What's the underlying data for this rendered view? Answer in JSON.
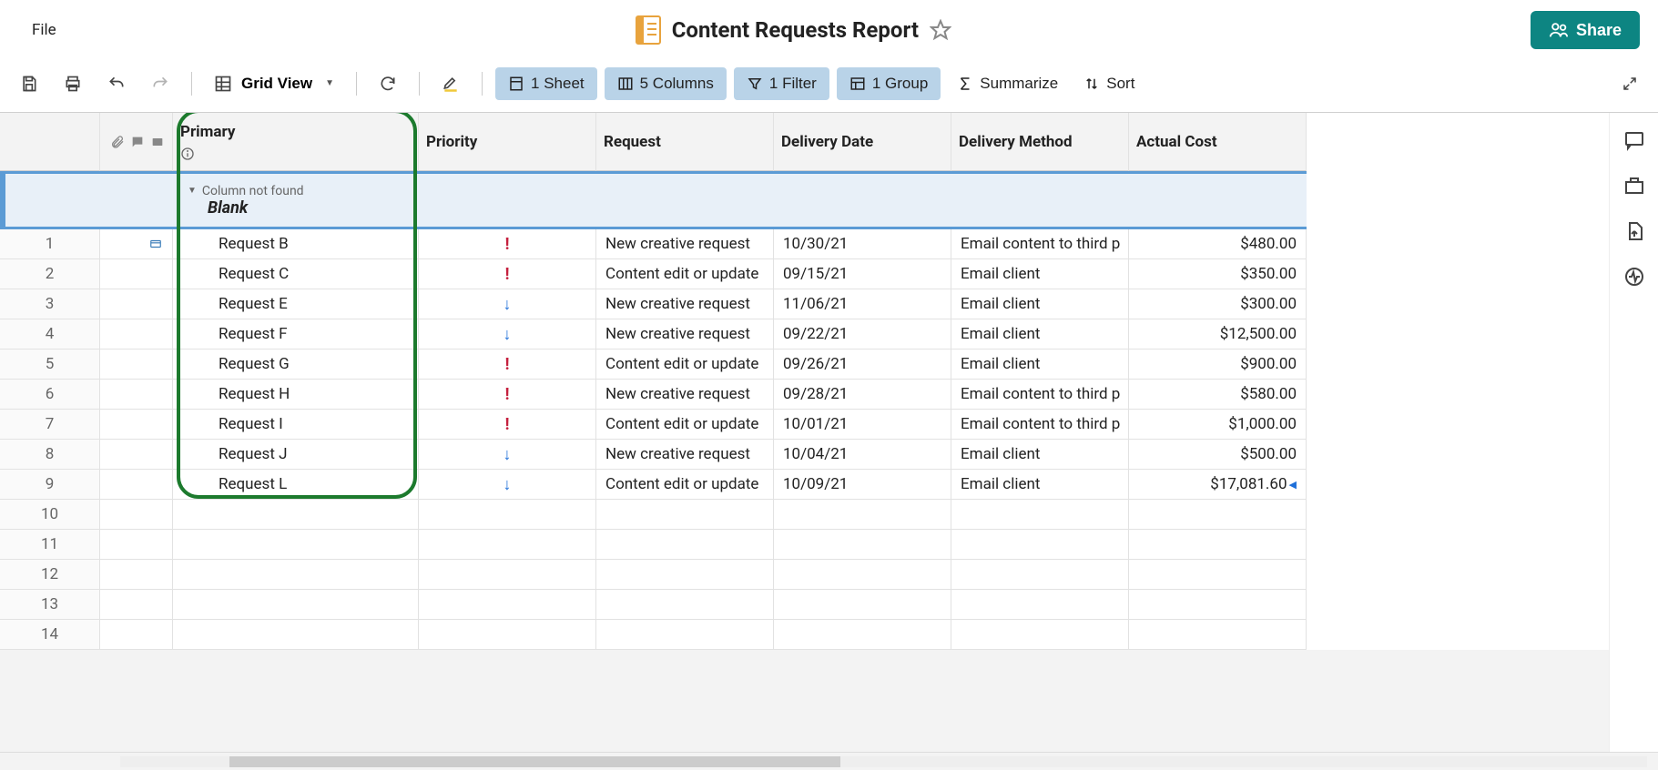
{
  "menu": {
    "file": "File"
  },
  "doc": {
    "title": "Content Requests Report"
  },
  "share": {
    "label": "Share"
  },
  "toolbar": {
    "grid_view": "Grid View",
    "sheet": "1 Sheet",
    "columns": "5 Columns",
    "filter": "1 Filter",
    "group": "1 Group",
    "summarize": "Summarize",
    "sort": "Sort"
  },
  "columns": {
    "primary": "Primary",
    "priority": "Priority",
    "request": "Request",
    "delivery_date": "Delivery Date",
    "delivery_method": "Delivery Method",
    "actual_cost": "Actual Cost"
  },
  "group_header": {
    "not_found": "Column not found",
    "blank": "Blank"
  },
  "rows": [
    {
      "n": "1",
      "primary": "Request B",
      "priority": "high",
      "request": "New creative request",
      "date": "10/30/21",
      "method": "Email content to third p",
      "cost": "$480.00",
      "icon": true
    },
    {
      "n": "2",
      "primary": "Request C",
      "priority": "high",
      "request": "Content edit or update",
      "date": "09/15/21",
      "method": "Email client",
      "cost": "$350.00"
    },
    {
      "n": "3",
      "primary": "Request E",
      "priority": "low",
      "request": "New creative request",
      "date": "11/06/21",
      "method": "Email client",
      "cost": "$300.00"
    },
    {
      "n": "4",
      "primary": "Request F",
      "priority": "low",
      "request": "New creative request",
      "date": "09/22/21",
      "method": "Email client",
      "cost": "$12,500.00"
    },
    {
      "n": "5",
      "primary": "Request G",
      "priority": "high",
      "request": "Content edit or update",
      "date": "09/26/21",
      "method": "Email client",
      "cost": "$900.00"
    },
    {
      "n": "6",
      "primary": "Request H",
      "priority": "high",
      "request": "New creative request",
      "date": "09/28/21",
      "method": "Email content to third p",
      "cost": "$580.00"
    },
    {
      "n": "7",
      "primary": "Request I",
      "priority": "high",
      "request": "Content edit or update",
      "date": "10/01/21",
      "method": "Email content to third p",
      "cost": "$1,000.00"
    },
    {
      "n": "8",
      "primary": "Request J",
      "priority": "low",
      "request": "New creative request",
      "date": "10/04/21",
      "method": "Email client",
      "cost": "$500.00"
    },
    {
      "n": "9",
      "primary": "Request L",
      "priority": "low",
      "request": "Content edit or update",
      "date": "10/09/21",
      "method": "Email client",
      "cost": "$17,081.60",
      "marker": true
    }
  ],
  "empty_rows": [
    "10",
    "11",
    "12",
    "13",
    "14"
  ]
}
